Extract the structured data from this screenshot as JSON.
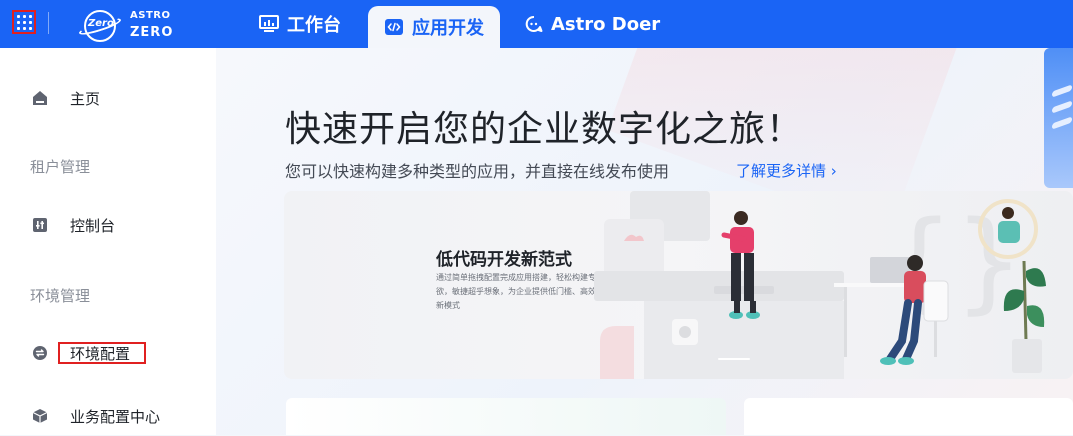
{
  "topbar": {
    "logo": {
      "line1": "ASTRO",
      "line2": "ZERO",
      "badge": "Zero"
    },
    "tabs": [
      {
        "label": "工作台",
        "icon": "dashboard-icon",
        "active": false
      },
      {
        "label": "应用开发",
        "icon": "code-icon",
        "active": true
      },
      {
        "label": "Astro Doer",
        "icon": "chat-bot-icon",
        "active": false
      }
    ],
    "colors": {
      "brand": "#1a64f5",
      "highlight": "#e02020"
    }
  },
  "sidebar": {
    "items": [
      {
        "label": "主页",
        "icon": "home-icon"
      },
      {
        "label": "控制台",
        "icon": "sliders-icon"
      },
      {
        "label": "环境配置",
        "icon": "swap-icon"
      },
      {
        "label": "业务配置中心",
        "icon": "cube-icon"
      }
    ],
    "groups": [
      "租户管理",
      "环境管理"
    ]
  },
  "main": {
    "title": "快速开启您的企业数字化之旅！",
    "subtitle": "您可以快速构建多种类型的应用，并直接在线发布使用",
    "link": "了解更多详情",
    "banner": {
      "title": "低代码开发新范式",
      "desc": "通过简单拖拽配置完成应用搭建，轻松构建专业级应用，创新随心所欲，敏捷超乎想象，为企业提供低门槛、高效率的数字化业务应用生产新模式"
    }
  }
}
